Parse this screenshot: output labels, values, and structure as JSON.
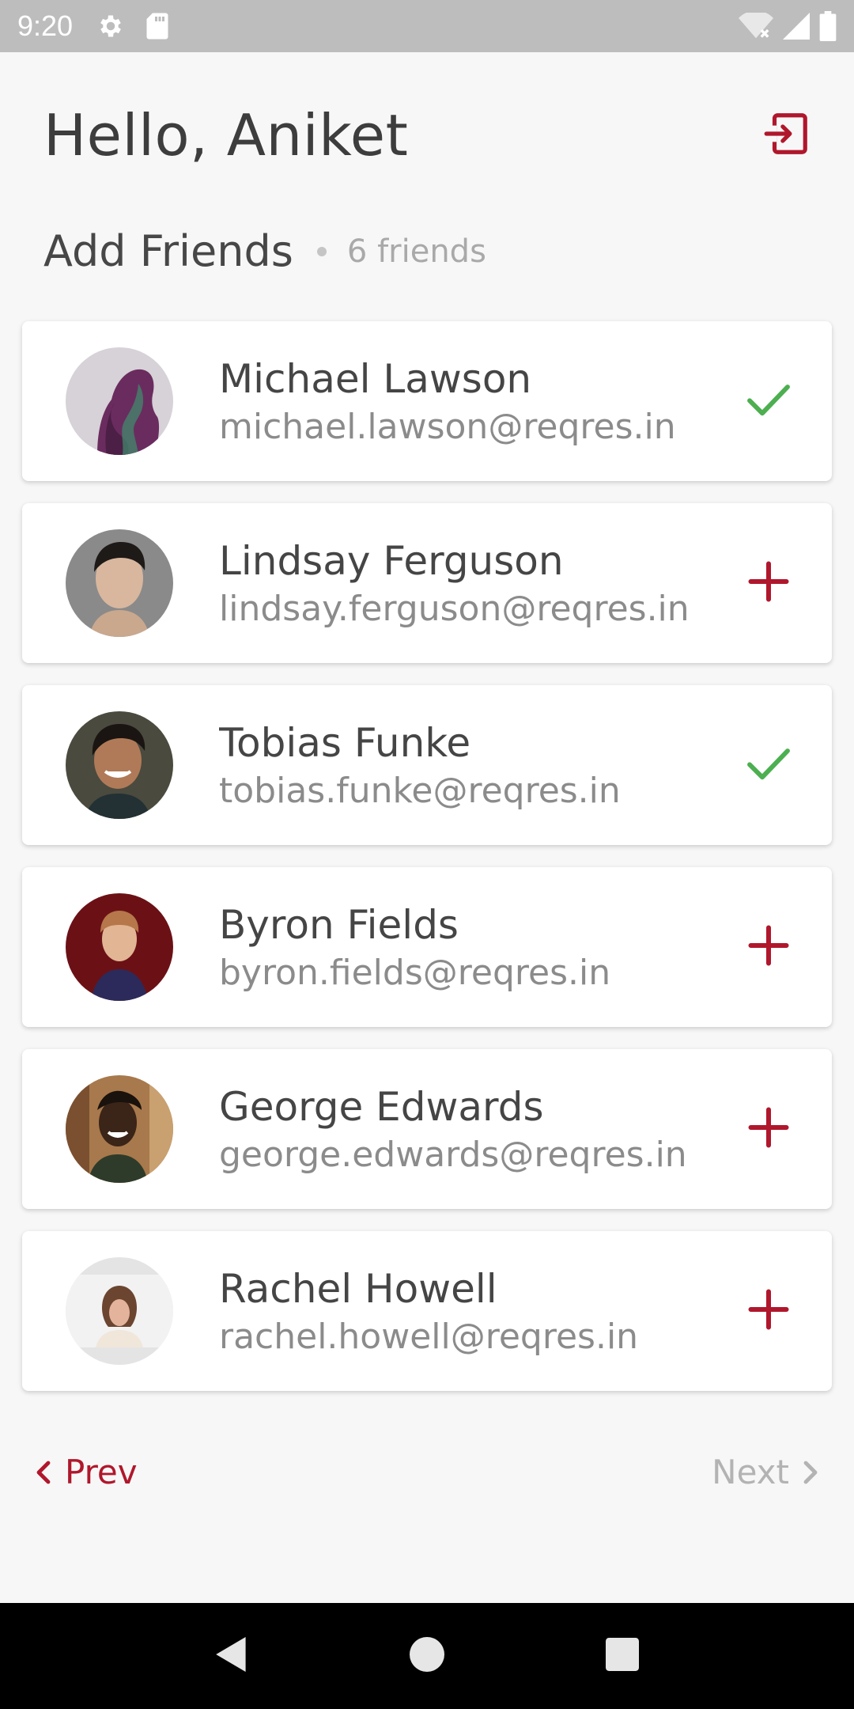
{
  "status_bar": {
    "time": "9:20"
  },
  "header": {
    "greeting": "Hello, Aniket",
    "logout_icon": "logout-icon"
  },
  "section": {
    "title": "Add Friends",
    "count": "6 friends"
  },
  "friends": [
    {
      "name": "Michael Lawson",
      "email": "michael.lawson@reqres.in",
      "status": "added",
      "icon": "check-icon"
    },
    {
      "name": "Lindsay Ferguson",
      "email": "lindsay.ferguson@reqres.in",
      "status": "add",
      "icon": "plus-icon"
    },
    {
      "name": "Tobias Funke",
      "email": "tobias.funke@reqres.in",
      "status": "added",
      "icon": "check-icon"
    },
    {
      "name": "Byron Fields",
      "email": "byron.fields@reqres.in",
      "status": "add",
      "icon": "plus-icon"
    },
    {
      "name": "George Edwards",
      "email": "george.edwards@reqres.in",
      "status": "add",
      "icon": "plus-icon"
    },
    {
      "name": "Rachel Howell",
      "email": "rachel.howell@reqres.in",
      "status": "add",
      "icon": "plus-icon"
    }
  ],
  "pager": {
    "prev_label": "Prev",
    "next_label": "Next"
  },
  "colors": {
    "accent": "#b0172c",
    "check": "#4caf50",
    "disabled": "#b3b3b3"
  }
}
